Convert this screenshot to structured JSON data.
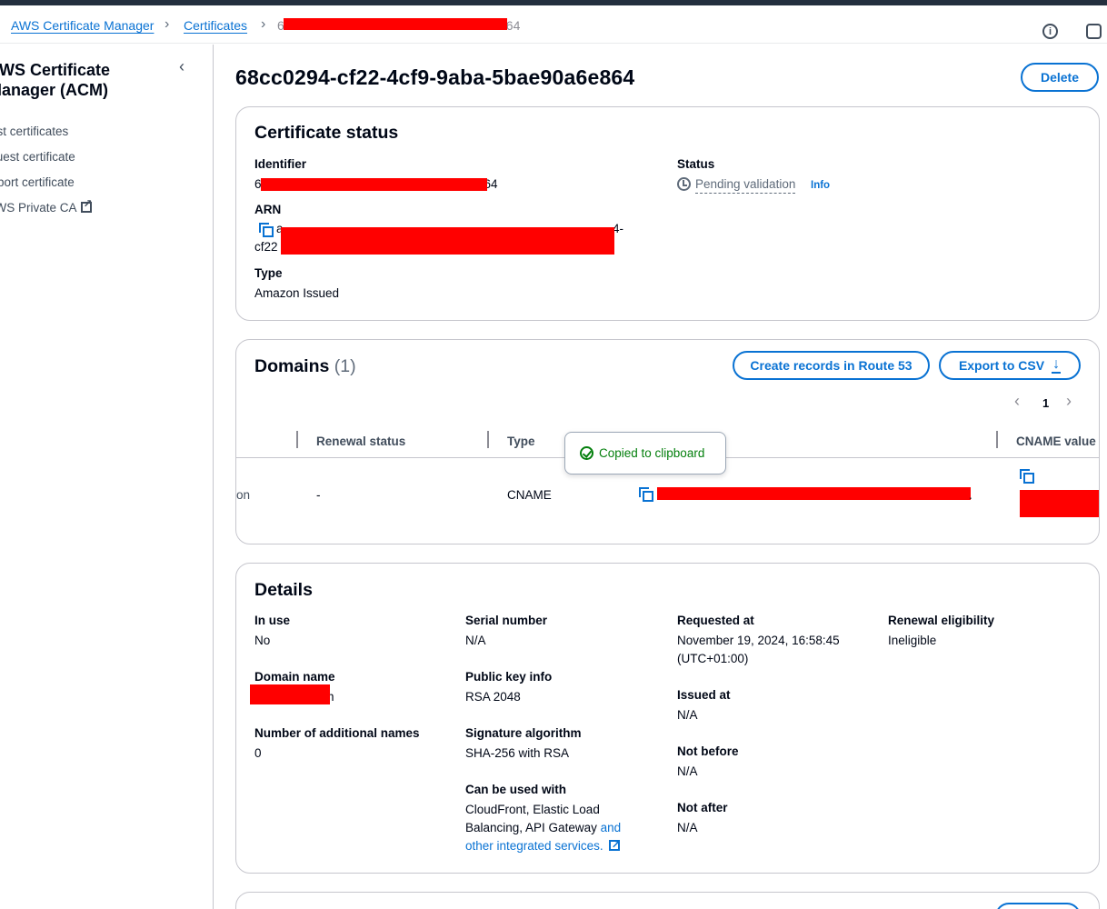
{
  "breadcrumb": {
    "items": [
      "AWS Certificate Manager",
      "Certificates"
    ],
    "current_prefix": "6",
    "current_suffix": "64"
  },
  "sidebar": {
    "title": "AWS Certificate Manager (ACM)",
    "items": [
      {
        "label": "List certificates"
      },
      {
        "label": "Request certificate"
      },
      {
        "label": "Import certificate"
      },
      {
        "label": "AWS Private CA"
      }
    ]
  },
  "page": {
    "title": "68cc0294-cf22-4cf9-9aba-5bae90a6e864",
    "delete_label": "Delete"
  },
  "certificate_status": {
    "title": "Certificate status",
    "identifier_label": "Identifier",
    "identifier_prefix": "6",
    "identifier_suffix": "64",
    "status_label": "Status",
    "status_value": "Pending validation",
    "info_label": "Info",
    "arn_label": "ARN",
    "arn_line1_visible": "a",
    "arn_line1_tail": "4-",
    "arn_line2_prefix": "cf22",
    "type_label": "Type",
    "type_value": "Amazon Issued"
  },
  "domains": {
    "title": "Domains",
    "count": "(1)",
    "create_records_label": "Create records in Route 53",
    "export_label": "Export to CSV",
    "page_number": "1",
    "columns": [
      "Renewal status",
      "Type",
      "CNAME value"
    ],
    "row": {
      "status_fragment": "on",
      "renewal_status": "-",
      "type": "CNAME",
      "cname_name_tail": "."
    },
    "tooltip": "Copied to clipboard"
  },
  "details": {
    "title": "Details",
    "in_use_label": "In use",
    "in_use_value": "No",
    "domain_name_label": "Domain name",
    "domain_name_tail": "n",
    "additional_names_label": "Number of additional names",
    "additional_names_value": "0",
    "serial_label": "Serial number",
    "serial_value": "N/A",
    "public_key_label": "Public key info",
    "public_key_value": "RSA 2048",
    "signature_label": "Signature algorithm",
    "signature_value": "SHA-256 with RSA",
    "usable_label": "Can be used with",
    "usable_value_line1": "CloudFront, Elastic Load",
    "usable_value_line2": "Balancing, API Gateway",
    "usable_link_1": "and",
    "usable_link_2": "other integrated services.",
    "requested_label": "Requested at",
    "requested_value_line1": "November 19, 2024, 16:58:45",
    "requested_value_line2": "(UTC+01:00)",
    "issued_label": "Issued at",
    "issued_value": "N/A",
    "not_before_label": "Not before",
    "not_before_value": "N/A",
    "not_after_label": "Not after",
    "not_after_value": "N/A",
    "renewal_label": "Renewal eligibility",
    "renewal_value": "Ineligible"
  },
  "colors": {
    "link": "#0972d3",
    "success": "#037f0c",
    "redaction": "#ff0000"
  }
}
